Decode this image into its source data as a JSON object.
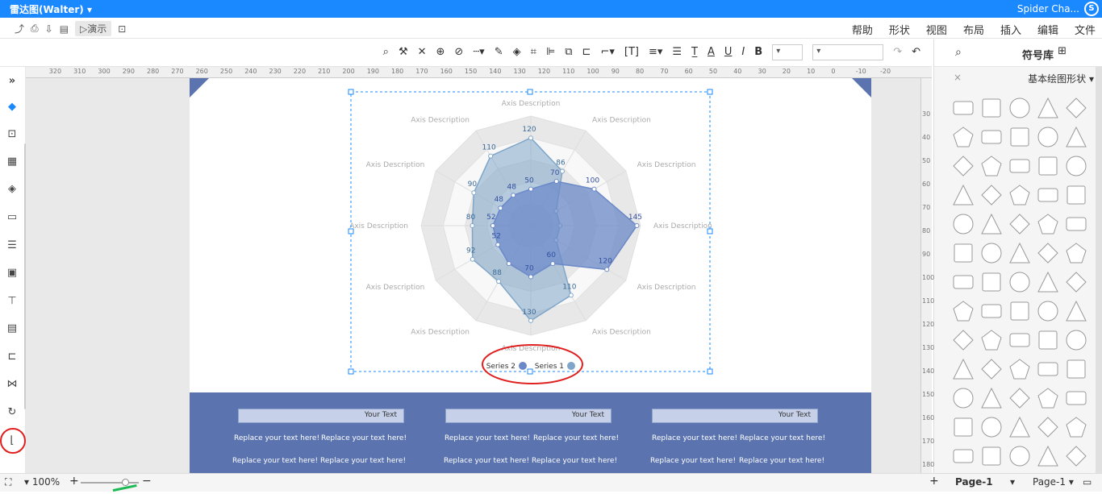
{
  "titlebar": {
    "app_title": "Spider Cha...",
    "doc_title": "雷达图(Walter)",
    "logo": "S"
  },
  "menu": {
    "items": [
      "文件",
      "编辑",
      "插入",
      "布局",
      "视图",
      "形状",
      "帮助"
    ],
    "present_label": "演示"
  },
  "toolbar": {
    "font_size_value": "",
    "font_family_value": ""
  },
  "right_panel": {
    "title": "符号库",
    "category": "基本绘图形状",
    "shapes": [
      "rounded-square",
      "square",
      "circle",
      "rectangle",
      "square-outline",
      "diamond",
      "pentagon",
      "rounded-rect",
      "triangle",
      "double-rect",
      "trapezoid",
      "parallelogram",
      "circle-ring",
      "circle-dot",
      "ellipse",
      "pentagon2",
      "diamond-wide",
      "pill",
      "right-triangle",
      "triangle2",
      "hexagon",
      "heptagon",
      "octagon",
      "octagon2",
      "hexagon2",
      "doc-shape",
      "tag",
      "thick-square",
      "star5",
      "heart",
      "three-point-star",
      "kite",
      "cone",
      "flag",
      "half-circle",
      "gear-star",
      "star6",
      "star7",
      "star5b",
      "star4",
      "gear",
      "burst",
      "four-point",
      "diamond-sq",
      "circle-gear",
      "square3",
      "rect3",
      "rect4",
      "leaf",
      "half-round",
      "shield",
      "teardrop",
      "quarter-circle",
      "cloud",
      "half-disc",
      "oval-pointed",
      "egg",
      "shield2",
      "octagon3",
      "sun",
      "wave",
      "square-star",
      "diamond3",
      "rect5",
      "ticket"
    ]
  },
  "rulers": {
    "top": [
      "-20",
      "-10",
      "0",
      "10",
      "20",
      "30",
      "40",
      "50",
      "60",
      "70",
      "80",
      "90",
      "100",
      "110",
      "120",
      "130",
      "140",
      "150",
      "160",
      "170",
      "180",
      "190",
      "200",
      "210",
      "220",
      "230",
      "240",
      "250",
      "260",
      "270",
      "280",
      "290",
      "300",
      "310",
      "320"
    ],
    "right": [
      "30",
      "40",
      "50",
      "60",
      "70",
      "80",
      "90",
      "100",
      "110",
      "120",
      "130",
      "140",
      "150",
      "160",
      "170",
      "180"
    ]
  },
  "chart_data": {
    "type": "radar",
    "categories": [
      "Axis Description",
      "Axis Description",
      "Axis Description",
      "Axis Description",
      "Axis Description",
      "Axis Description",
      "Axis Description",
      "Axis Description",
      "Axis Description",
      "Axis Description",
      "Axis Description",
      "Axis Description"
    ],
    "series": [
      {
        "name": "Series 1",
        "color": "#7fa6c9",
        "values": [
          120,
          86,
          40,
          40,
          40,
          110,
          130,
          88,
          92,
          80,
          90,
          110
        ]
      },
      {
        "name": "Series 2",
        "color": "#6b89c8",
        "values": [
          50,
          70,
          100,
          145,
          120,
          60,
          70,
          60,
          52,
          52,
          48,
          48
        ]
      }
    ],
    "value_labels": {
      "series1": [
        "120",
        "86",
        "",
        "",
        "",
        "110",
        "130",
        "88",
        "92",
        "80",
        "90",
        "110"
      ],
      "series2": [
        "50",
        "70",
        "100",
        "145",
        "120",
        "60",
        "70",
        "",
        "52",
        "52",
        "48",
        "48"
      ]
    },
    "r_max": 150,
    "legend_position": "bottom"
  },
  "footer": {
    "boxes": [
      "Your Text",
      "Your Text",
      "Your Text"
    ],
    "line": "Replace your text here!"
  },
  "statusbar": {
    "page_label": "Page-1",
    "page_tab": "Page-1",
    "zoom": "100%"
  }
}
